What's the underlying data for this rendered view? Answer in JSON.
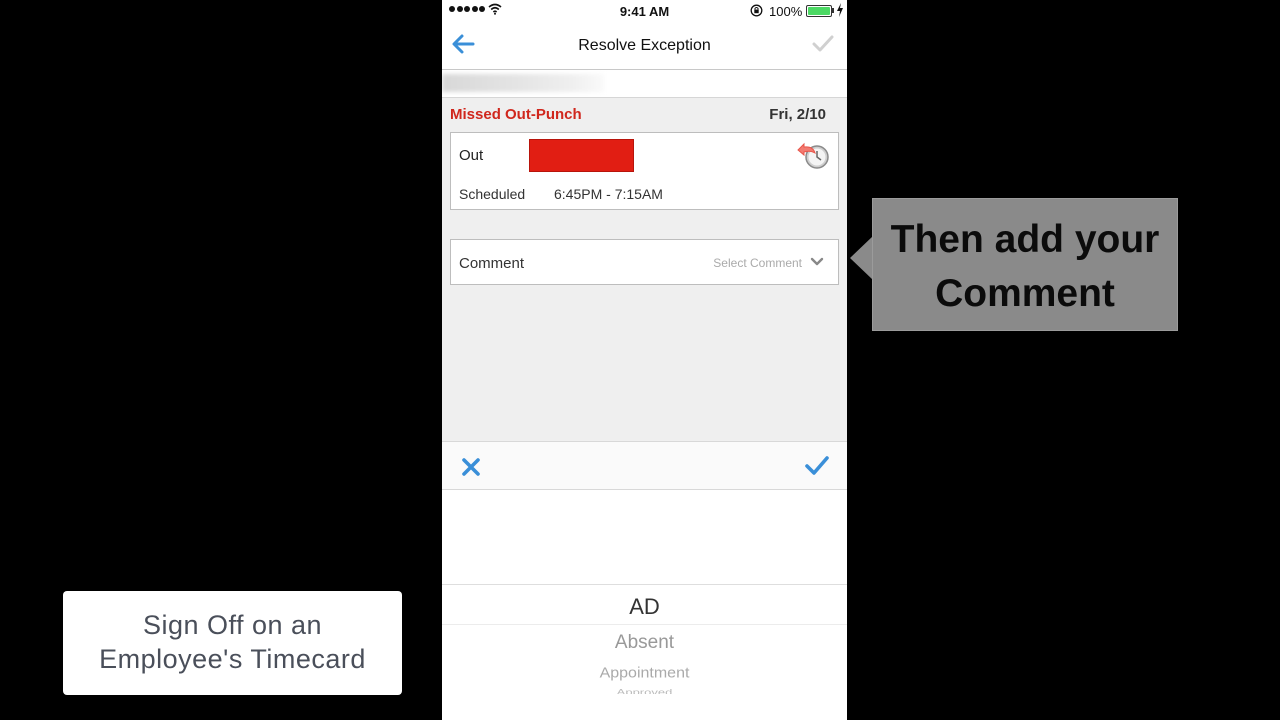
{
  "status_bar": {
    "time": "9:41 AM",
    "battery_percent": "100%",
    "battery_level": 1.0,
    "icons": [
      "signal-dots",
      "wifi-icon",
      "rotation-lock-icon",
      "battery-icon",
      "charging-bolt-icon"
    ]
  },
  "nav": {
    "title": "Resolve Exception",
    "back_icon": "arrow-left-icon",
    "done_icon": "checkmark-icon"
  },
  "exception": {
    "title": "Missed Out-Punch",
    "date": "Fri, 2/10",
    "out_label": "Out",
    "scheduled_label": "Scheduled",
    "scheduled_value": "6:45PM - 7:15AM",
    "history_icon": "undo-clock-icon"
  },
  "comment": {
    "label": "Comment",
    "select_placeholder": "Select Comment"
  },
  "picker": {
    "options": [
      "AD",
      "Absent",
      "Appointment",
      "Approved"
    ],
    "selected": "AD"
  },
  "callout": {
    "line1": "Then add your",
    "line2": "Comment"
  },
  "title_card": {
    "line1": "Sign Off on an",
    "line2": "Employee's Timecard"
  },
  "colors": {
    "accent_blue": "#3a8fd8",
    "exception_red": "#d0271d",
    "battery_green": "#4cd964",
    "callout_gray": "#8a8a8a"
  }
}
